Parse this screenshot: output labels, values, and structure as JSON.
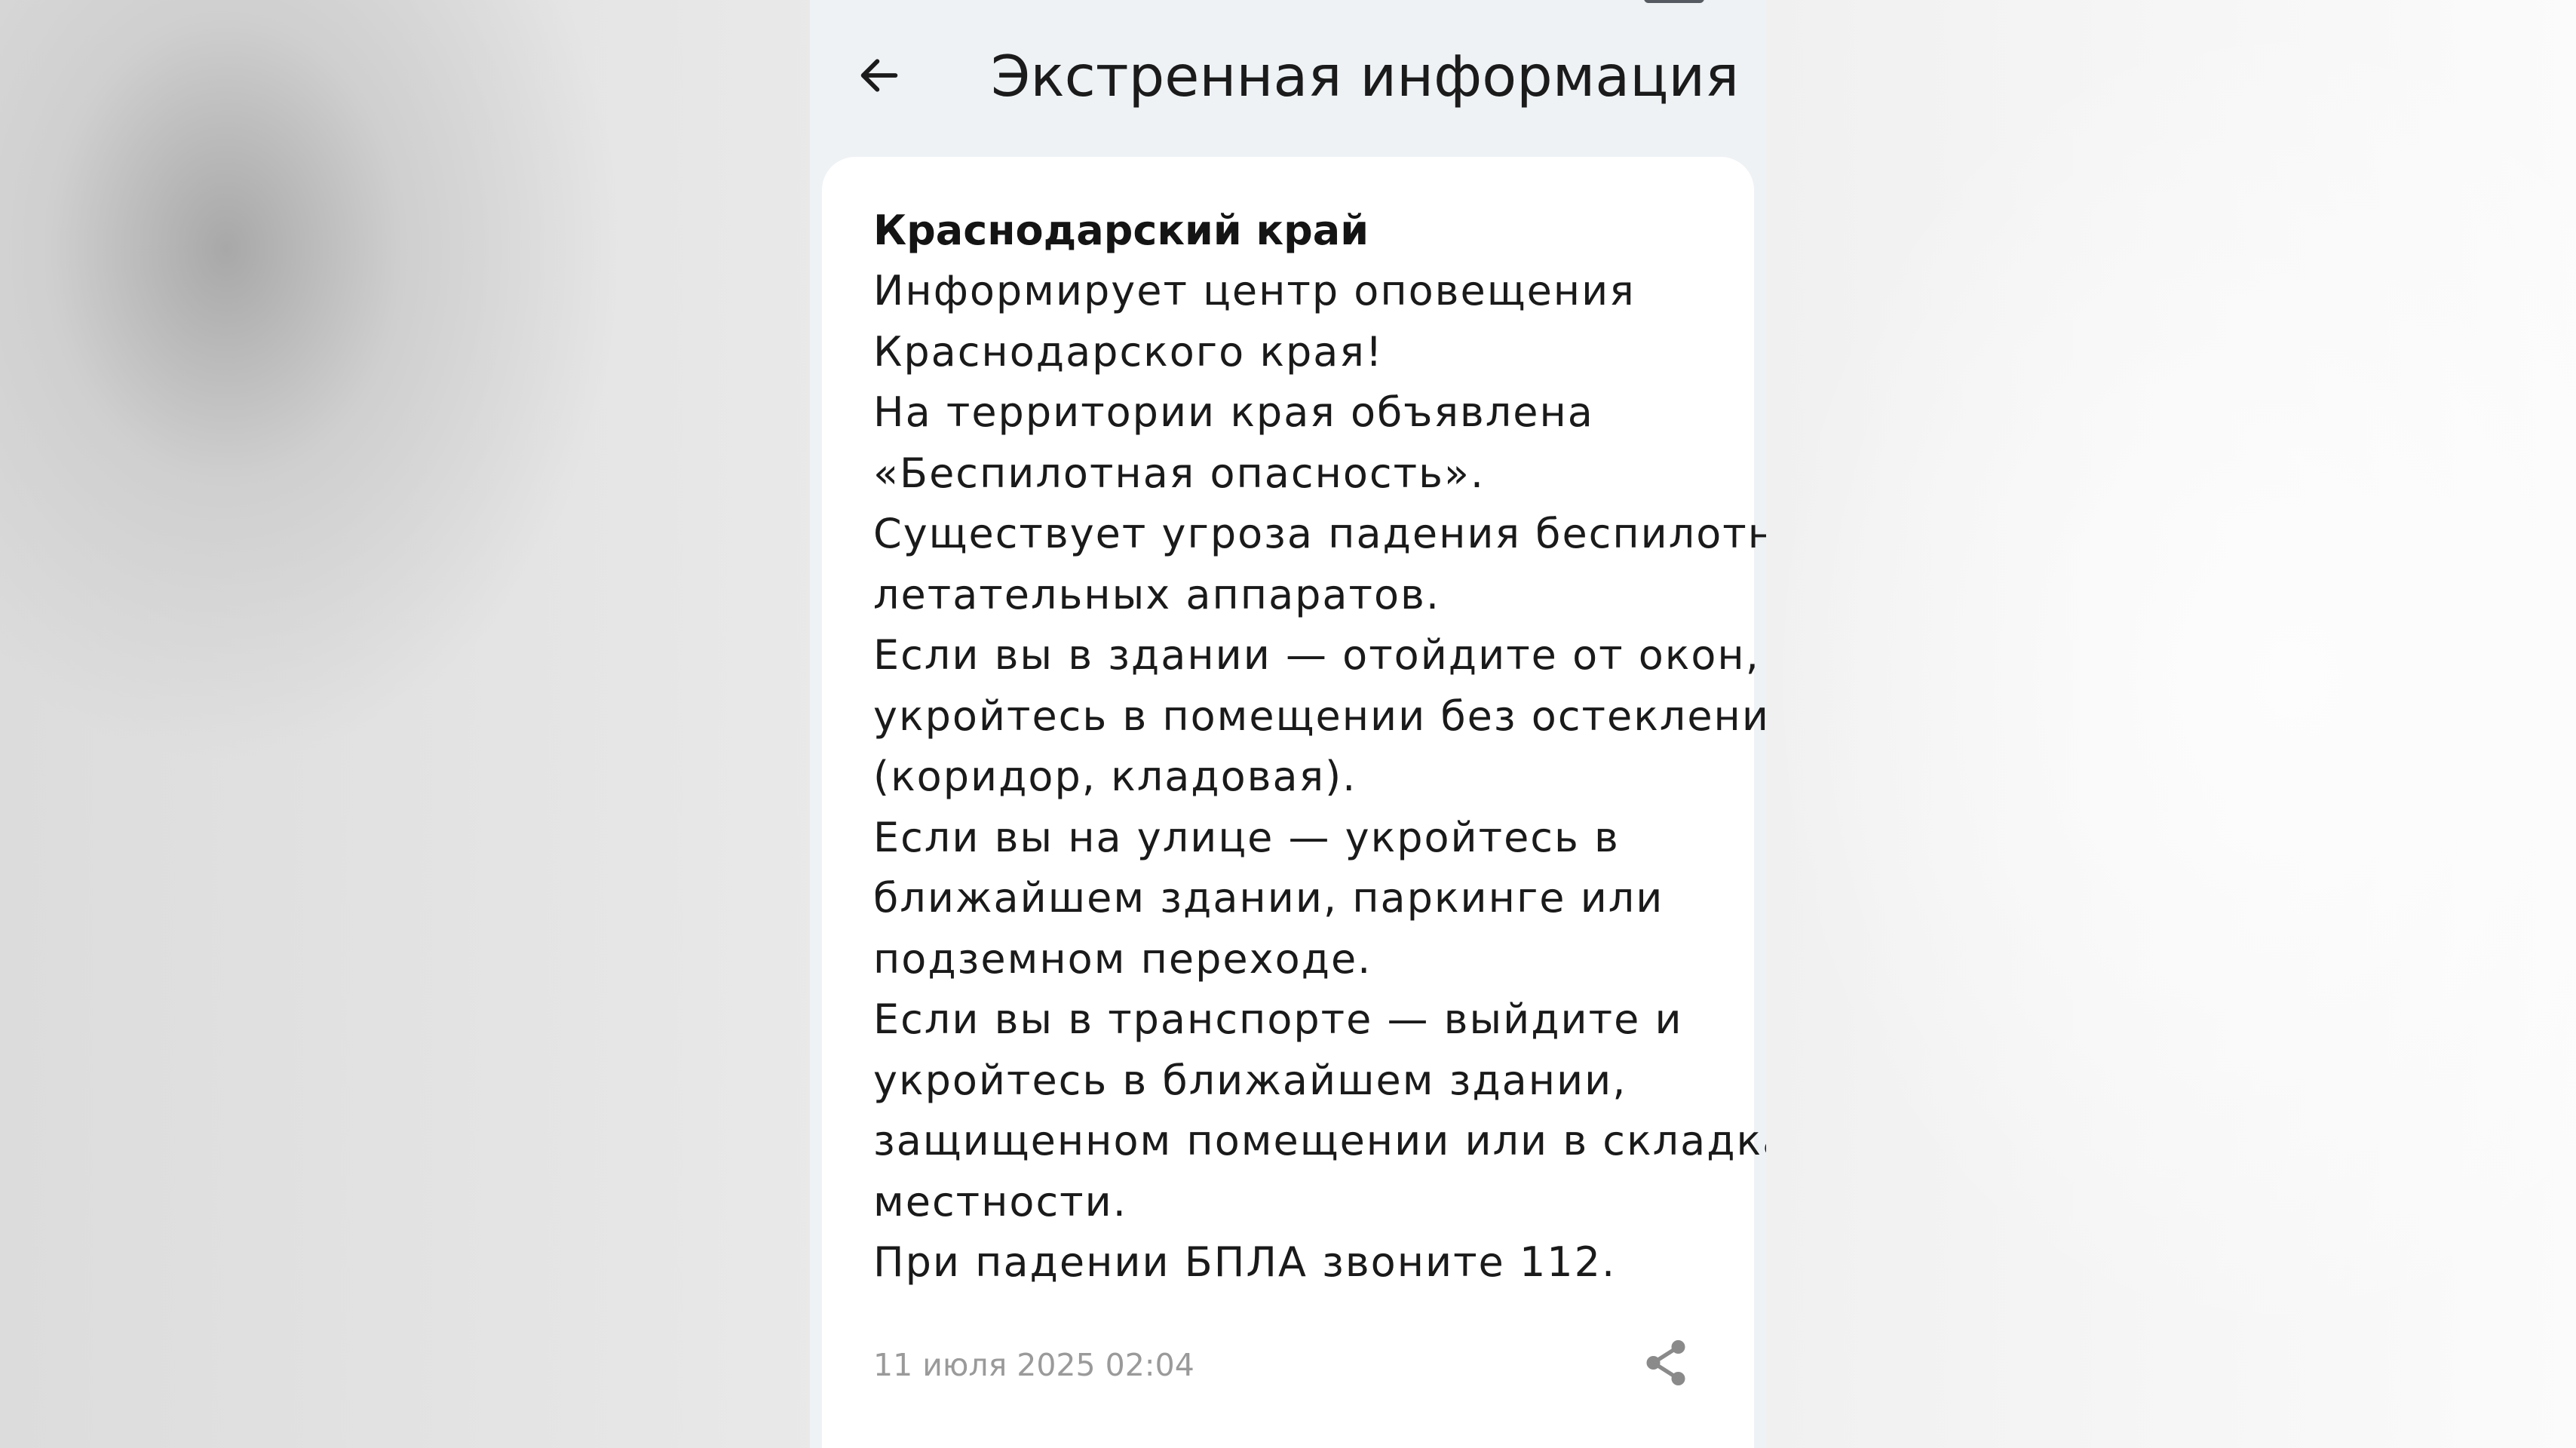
{
  "header": {
    "title": "Экстренная информация",
    "back_icon": "arrow-left-icon"
  },
  "message": {
    "region_title": "Краснодарский край",
    "lines": [
      "Информирует центр оповещения",
      "Краснодарского края!",
      "На территории края объявлена",
      "«Беспилотная опасность».",
      "Существует угроза падения беспилотных",
      "летательных аппаратов.",
      "Если вы в здании — отойдите от окон,",
      "укройтесь в помещении без остекления",
      "(коридор, кладовая).",
      "Если вы на улице — укройтесь в",
      "ближайшем здании, паркинге или",
      "подземном переходе.",
      "Если вы в транспорте — выйдите и",
      "укройтесь в ближайшем здании,",
      "защищенном помещении или в складках",
      "местности.",
      "При падении БПЛА звоните 112."
    ],
    "timestamp": "11 июля 2025 02:04",
    "share_icon": "share-icon"
  },
  "colors": {
    "screen_background": "#eef2f5",
    "card_background": "#ffffff",
    "text_primary": "#1a1a1a",
    "text_secondary": "#9a9a9a",
    "icon_gray": "#8a8a8a"
  }
}
